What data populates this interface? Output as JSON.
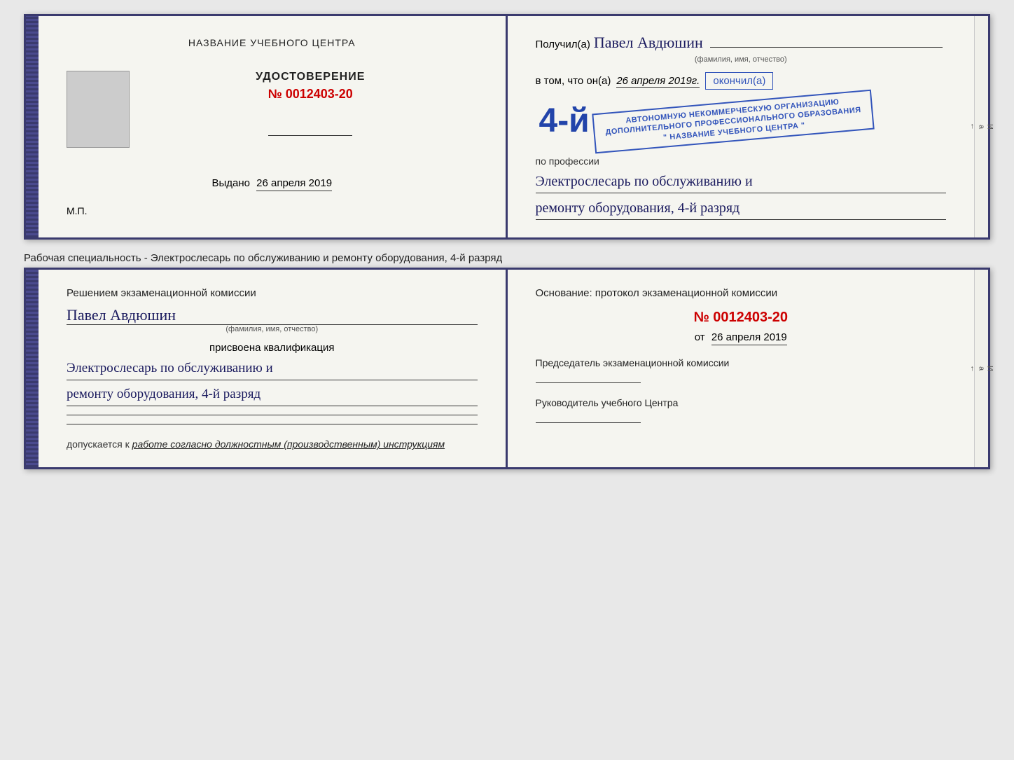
{
  "top_certificate": {
    "left": {
      "title": "НАЗВАНИЕ УЧЕБНОГО ЦЕНТРА",
      "udostoverenie_label": "УДОСТОВЕРЕНИЕ",
      "number": "№ 0012403-20",
      "vydano_label": "Выдано",
      "vydano_date": "26 апреля 2019",
      "mp_label": "М.П."
    },
    "right": {
      "poluchil_label": "Получил(a)",
      "fio": "Павел Авдюшин",
      "fio_subtext": "(фамилия, имя, отчество)",
      "vtom_label": "в том, что он(а)",
      "vtom_date": "26 апреля 2019г.",
      "okonchil_label": "окончил(а)",
      "grade": "4-й",
      "stamp_line1": "АВТОНОМНУЮ НЕКОММЕРЧЕСКУЮ ОРГАНИЗАЦИЮ",
      "stamp_line2": "ДОПОЛНИТЕЛЬНОГО ПРОФЕССИОНАЛЬНОГО ОБРАЗОВАНИЯ",
      "stamp_line3": "\" НАЗВАНИЕ УЧЕБНОГО ЦЕНТРА \"",
      "po_professii": "по профессии",
      "profession1": "Электрослесарь по обслуживанию и",
      "profession2": "ремонту оборудования, 4-й разряд"
    }
  },
  "divider_text": "Рабочая специальность - Электрослесарь по обслуживанию и ремонту оборудования, 4-й разряд",
  "bottom_certificate": {
    "left": {
      "resheniem": "Решением экзаменационной комиссии",
      "fio": "Павел Авдюшин",
      "fio_subtext": "(фамилия, имя, отчество)",
      "prisvoena": "присвоена квалификация",
      "qualification1": "Электрослесарь по обслуживанию и",
      "qualification2": "ремонту оборудования, 4-й разряд",
      "dopuskaetsya": "допускается к",
      "dopusk_text": "работе согласно должностным (производственным) инструкциям"
    },
    "right": {
      "osnovanie": "Основание: протокол экзаменационной комиссии",
      "protocol_number": "№ 0012403-20",
      "ot_label": "от",
      "ot_date": "26 апреля 2019",
      "predsedatel_label": "Председатель экзаменационной комиссии",
      "rukovoditel_label": "Руководитель учебного Центра"
    }
  },
  "right_edge_chars": [
    "И",
    "а",
    "←"
  ]
}
